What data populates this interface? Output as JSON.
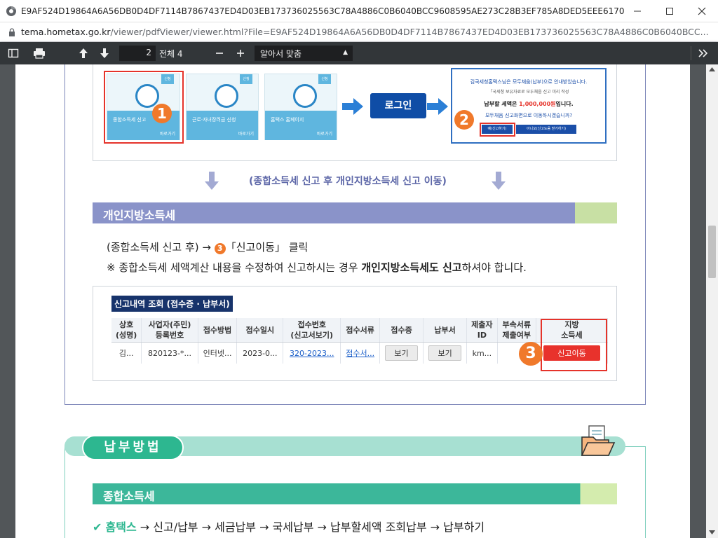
{
  "window": {
    "title": "E9AF524D19864A6A56DB0D4DF7114B7867437ED4D03EB173736025563C78A4886C0B6040BCC9608595AE273C28B3EF785A8DED5EEE6170DA00791A11F259..."
  },
  "address": {
    "host": "tema.hometax.go.kr",
    "path": "/viewer/pdfViewer/viewer.html?File=E9AF524D19864A6A56DB0D4DF7114B7867437ED4D03EB173736025563C78A4886C0B6040BCC..."
  },
  "toolbar": {
    "page_number": "2",
    "page_total": "전체 4",
    "zoom_selected": "알아서 맞춤"
  },
  "flow": {
    "cards": [
      {
        "label": "종합소득세 신고",
        "more": "바로가기",
        "badge": "신청"
      },
      {
        "label": "근로·자녀장려금 신청",
        "more": "바로가기",
        "badge": "신청"
      },
      {
        "label": "홈택스 홈페이지",
        "more": "바로가기",
        "badge": "신청"
      }
    ],
    "step1": "1",
    "login_label": "로그인",
    "step2": "2",
    "notice": {
      "line1": "김국세청홈택스님은 모두채움(납부)으로 안내받았습니다.",
      "line2": "「국세청 보유자료로 모두채움 신고 미리 작성",
      "amount_prefix": "납부할 세액은 ",
      "amount": "1,000,000원",
      "amount_suffix": "입니다.",
      "question": "모두채움 신고화면으로 이동하시겠습니까?",
      "yes_btn": "예(신고하기)",
      "no_btn": "아니오(신고도움 받기하기)"
    }
  },
  "transition_text": "(종합소득세 신고 후 개인지방소득세 신고 이동)",
  "local_tax": {
    "section_title": "개인지방소득세",
    "line1_prefix": "(종합소득세 신고 후) → ",
    "line1_num": "3",
    "line1_suffix": "「신고이동」 클릭",
    "line2_prefix": "※ 종합소득세 세액계산 내용을 수정하여 신고하시는 경우 ",
    "line2_bold": "개인지방소득세도 신고",
    "line2_suffix": "하셔야 합니다."
  },
  "history": {
    "title": "신고내역 조회 (접수증 · 납부서)",
    "columns": [
      [
        "상호",
        "(성명)"
      ],
      [
        "사업자(주민)",
        "등록번호"
      ],
      [
        "접수방법"
      ],
      [
        "접수일시"
      ],
      [
        "접수번호",
        "(신고서보기)"
      ],
      [
        "접수서류"
      ],
      [
        "접수증"
      ],
      [
        "납부서"
      ],
      [
        "제출자",
        "ID"
      ],
      [
        "부속서류",
        "제출여부"
      ],
      [
        "지방",
        "소득세"
      ]
    ],
    "row": {
      "name": "김...",
      "regno": "820123-*...",
      "method": "인터넷...",
      "date": "2023-0...",
      "receipt_no": "320-2023...",
      "docs": "접수서...",
      "receipt_btn": "보기",
      "payment_btn": "보기",
      "submitter": "km...",
      "attach": "",
      "local_btn": "신고이동"
    },
    "step3": "3"
  },
  "payment": {
    "header": "납부방법",
    "section_title": "종합소득세",
    "check": "✔",
    "route_bold": "홈택스",
    "route": " → 신고/납부 → 세금납부 → 국세납부 → 납부할세액 조회납부 → 납부하기"
  },
  "colors": {
    "accent_blue": "#1a5ec8",
    "step_orange": "#f0792b",
    "highlight_red": "#e5332a",
    "section_purple": "#8a93c9",
    "section_green": "#3cb79a"
  }
}
